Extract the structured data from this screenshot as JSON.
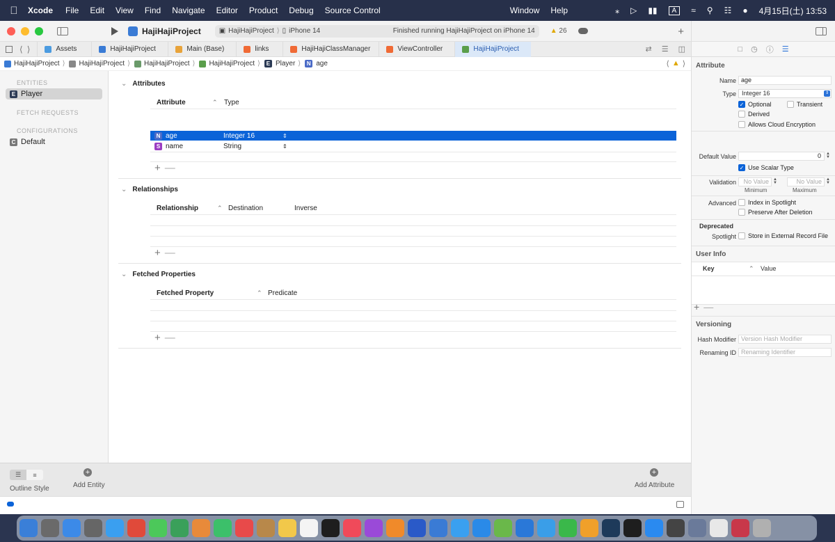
{
  "menubar": {
    "app_name": "Xcode",
    "items": [
      "File",
      "Edit",
      "View",
      "Find",
      "Navigate",
      "Editor",
      "Product",
      "Debug",
      "Source Control",
      "Window",
      "Help"
    ],
    "input_mode": "A",
    "clock": "4月15日(土) 13:53"
  },
  "toolbar": {
    "project_name": "HajiHajiProject",
    "scheme_target": "HajiHajiProject",
    "device": "iPhone 14",
    "status": "Finished running HajiHajiProject on iPhone 14",
    "warning_count": "26"
  },
  "tabs": [
    {
      "label": "Assets",
      "color": "#4b9be0"
    },
    {
      "label": "HajiHajiProject",
      "color": "#3a7bd5"
    },
    {
      "label": "Main (Base)",
      "color": "#e8a33a"
    },
    {
      "label": "links",
      "color": "#f06a35"
    },
    {
      "label": "HajiHajiClassManager",
      "color": "#f06a35"
    },
    {
      "label": "ViewController",
      "color": "#f06a35"
    },
    {
      "label": "HajiHajiProject",
      "color": "#5a9e4b"
    }
  ],
  "breadcrumb": [
    "HajiHajiProject",
    "HajiHajiProject",
    "HajiHajiProject",
    "HajiHajiProject",
    "Player",
    "age"
  ],
  "entities_panel": {
    "entities_header": "ENTITIES",
    "entity": "Player",
    "fetch_requests_header": "FETCH REQUESTS",
    "configurations_header": "CONFIGURATIONS",
    "configuration": "Default"
  },
  "editor": {
    "attributes_title": "Attributes",
    "attr_col_name": "Attribute",
    "attr_col_type": "Type",
    "attributes": [
      {
        "badge": "N",
        "name": "age",
        "type": "Integer 16"
      },
      {
        "badge": "S",
        "name": "name",
        "type": "String"
      }
    ],
    "relationships_title": "Relationships",
    "rel_col_name": "Relationship",
    "rel_col_dest": "Destination",
    "rel_col_inverse": "Inverse",
    "fetched_title": "Fetched Properties",
    "fp_col_name": "Fetched Property",
    "fp_col_predicate": "Predicate"
  },
  "bottombar": {
    "outline_style": "Outline Style",
    "add_entity": "Add Entity",
    "add_attribute": "Add Attribute"
  },
  "inspector": {
    "section_attribute": "Attribute",
    "name_label": "Name",
    "name_value": "age",
    "type_label": "Type",
    "type_value": "Integer 16",
    "optional": "Optional",
    "transient": "Transient",
    "derived": "Derived",
    "cloud_encryption": "Allows Cloud Encryption",
    "default_value_label": "Default Value",
    "default_value": "0",
    "use_scalar": "Use Scalar Type",
    "validation_label": "Validation",
    "no_value_placeholder": "No Value",
    "minimum": "Minimum",
    "maximum": "Maximum",
    "advanced_label": "Advanced",
    "index_spotlight": "Index in Spotlight",
    "preserve_deletion": "Preserve After Deletion",
    "deprecated_label": "Deprecated",
    "spotlight_label": "Spotlight",
    "store_external": "Store in External Record File",
    "user_info": "User Info",
    "key_col": "Key",
    "value_col": "Value",
    "versioning": "Versioning",
    "hash_modifier_label": "Hash Modifier",
    "hash_modifier_ph": "Version Hash Modifier",
    "renaming_id_label": "Renaming ID",
    "renaming_id_ph": "Renaming Identifier"
  },
  "dock_colors": [
    "#3a7fd8",
    "#6a6a6a",
    "#3c8ae8",
    "#666666",
    "#3a9ff0",
    "#e04a3a",
    "#4cc85a",
    "#3aa05a",
    "#e88a3a",
    "#3cc06a",
    "#e84a4a",
    "#b8884a",
    "#f2c84a",
    "#f4f4f4",
    "#1e1e1e",
    "#f04a5a",
    "#9a4ad8",
    "#f08a2a",
    "#2a5ac8",
    "#3a7bd5",
    "#3aa0f0",
    "#2a8ae8",
    "#6ab84a",
    "#2a78d8",
    "#3a9ee8",
    "#3ab84a",
    "#f0a02a",
    "#1e3a5a",
    "#1e1e1e",
    "#2a8af0",
    "#444444",
    "#6a7a9a",
    "#e8e8e8",
    "#c8384a",
    "#b0b0b0"
  ]
}
